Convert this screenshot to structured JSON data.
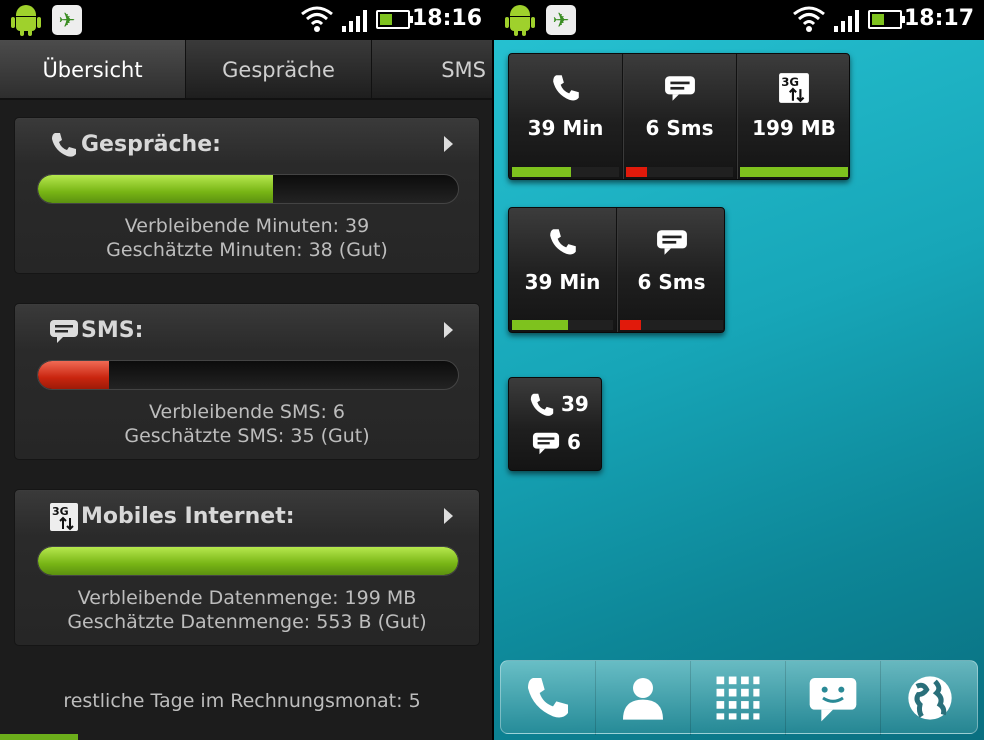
{
  "left": {
    "status": {
      "time": "18:16"
    },
    "tabs": [
      {
        "label": "Übersicht"
      },
      {
        "label": "Gespräche"
      },
      {
        "label": "SMS"
      }
    ],
    "cards": [
      {
        "title": "Gespräche:",
        "line1": "Verbleibende Minuten: 39",
        "line2": "Geschätzte Minuten: 38 (Gut)",
        "progress": 0.56,
        "color": "#78b515"
      },
      {
        "title": "SMS:",
        "line1": "Verbleibende SMS: 6",
        "line2": "Geschätzte SMS: 35 (Gut)",
        "progress": 0.17,
        "color": "#c9250f"
      },
      {
        "title": "Mobiles Internet:",
        "line1": "Verbleibende Datenmenge: 199 MB",
        "line2": "Geschätzte Datenmenge: 553 B (Gut)",
        "progress": 1.0,
        "color": "#78b515"
      }
    ],
    "footer": "restliche Tage im Rechnungsmonat:  5"
  },
  "right": {
    "status": {
      "time": "18:17"
    },
    "widget_large": [
      {
        "icon": "phone-icon",
        "value": "39 Min",
        "level": 0.55,
        "color": "#7ec21e"
      },
      {
        "icon": "sms-icon",
        "value": "6 Sms",
        "level": 0.2,
        "color": "#e11a0b"
      },
      {
        "icon": "3g-data-icon",
        "value": "199 MB",
        "level": 1.0,
        "color": "#7ec21e"
      }
    ],
    "widget_medium": [
      {
        "icon": "phone-icon",
        "value": "39 Min",
        "level": 0.55,
        "color": "#7ec21e"
      },
      {
        "icon": "sms-icon",
        "value": "6 Sms",
        "level": 0.2,
        "color": "#e11a0b"
      }
    ],
    "widget_small": {
      "calls": "39",
      "sms": "6"
    },
    "dock": [
      "phone-icon",
      "contacts-icon",
      "apps-grid-icon",
      "messaging-icon",
      "browser-globe-icon"
    ]
  }
}
